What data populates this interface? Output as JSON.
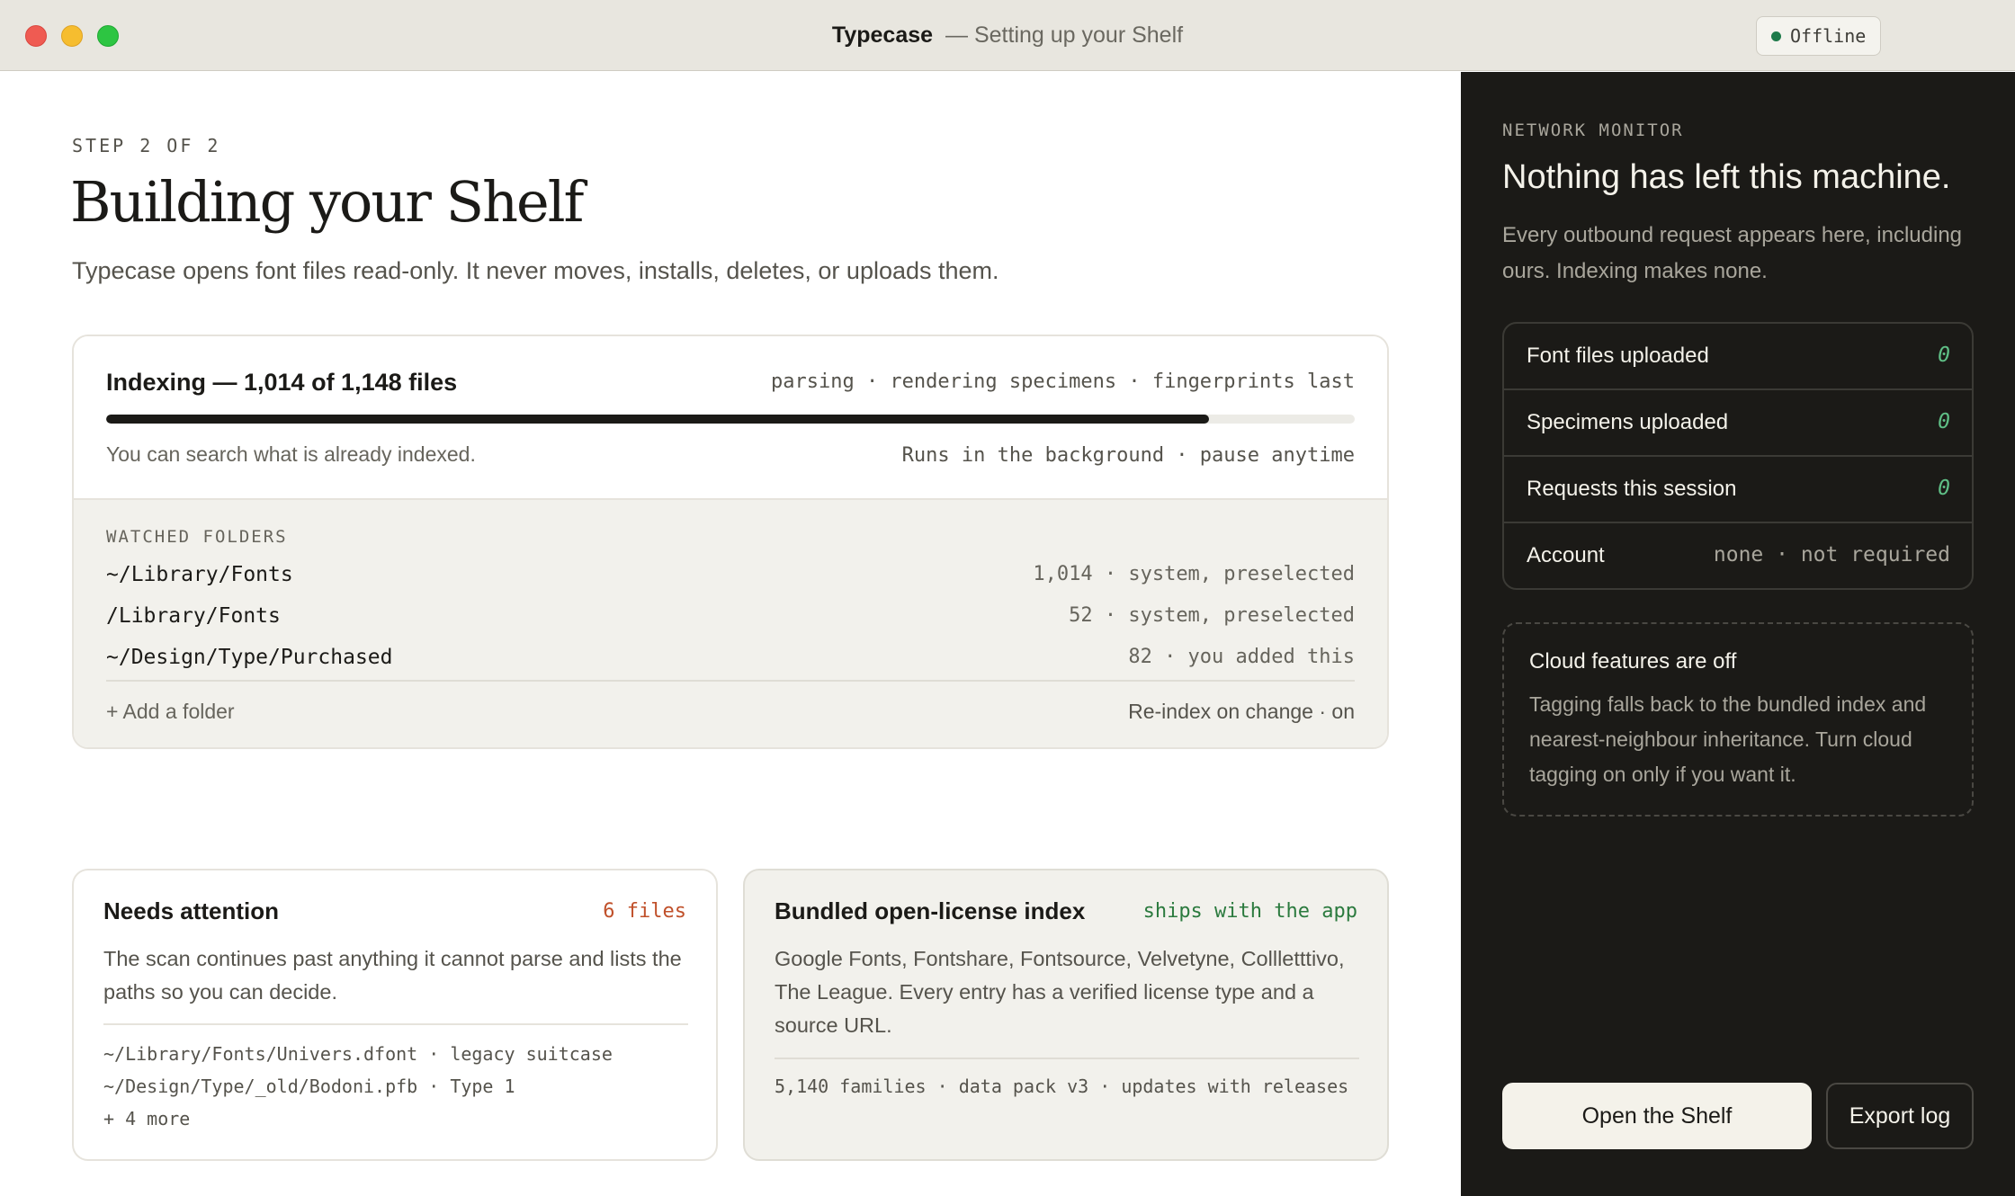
{
  "window": {
    "app_name": "Typecase",
    "subtitle": "— Setting up your Shelf",
    "status_badge": "Offline",
    "colors": {
      "status_dot": "#1e7a4a",
      "attention": "#c0502a",
      "ships": "#2b7a3e",
      "monitor_zero": "#5fbf86"
    }
  },
  "main": {
    "step": "STEP 2 OF 2",
    "heading": "Building your Shelf",
    "lead": "Typecase opens font files read-only. It never moves, installs, deletes, or uploads them.",
    "indexing": {
      "title": "Indexing — 1,014 of 1,148 files",
      "stages": "parsing · rendering specimens · fingerprints last",
      "progress_indexed": 1014,
      "progress_total": 1148,
      "note": "You can search what is already indexed.",
      "background_note": "Runs in the background · pause anytime"
    },
    "watched": {
      "label": "WATCHED FOLDERS",
      "folders": [
        {
          "path": "~/Library/Fonts",
          "meta": "1,014 · system, preselected"
        },
        {
          "path": "/Library/Fonts",
          "meta": "52 · system, preselected"
        },
        {
          "path": "~/Design/Type/Purchased",
          "meta": "82 · you added this"
        }
      ],
      "add_folder": "+ Add a folder",
      "reindex": "Re-index on change · on"
    },
    "attention": {
      "title": "Needs attention",
      "badge": "6 files",
      "text": "The scan continues past anything it cannot parse and lists the paths so you can decide.",
      "items": [
        "~/Library/Fonts/Univers.dfont · legacy suitcase",
        "~/Design/Type/_old/Bodoni.pfb · Type 1",
        "+ 4 more"
      ]
    },
    "bundled": {
      "title": "Bundled open-license index",
      "badge": "ships with the app",
      "text": "Google Fonts, Fontshare, Fontsource, Velvetyne, Collletttivo, The League. Every entry has a verified license type and a source URL.",
      "footer": "5,140 families · data pack v3 · updates with releases"
    }
  },
  "monitor": {
    "label": "NETWORK MONITOR",
    "title": "Nothing has left this machine.",
    "desc": "Every outbound request appears here, including ours. Indexing makes none.",
    "stats": [
      {
        "label": "Font files uploaded",
        "value": "0"
      },
      {
        "label": "Specimens uploaded",
        "value": "0"
      },
      {
        "label": "Requests this session",
        "value": "0"
      },
      {
        "label": "Account",
        "value": "none · not required"
      }
    ],
    "cloud_title": "Cloud features are off",
    "cloud_text": "Tagging falls back to the bundled index and nearest-neighbour inheritance. Turn cloud tagging on only if you want it.",
    "primary_button": "Open the Shelf",
    "secondary_button": "Export log"
  }
}
